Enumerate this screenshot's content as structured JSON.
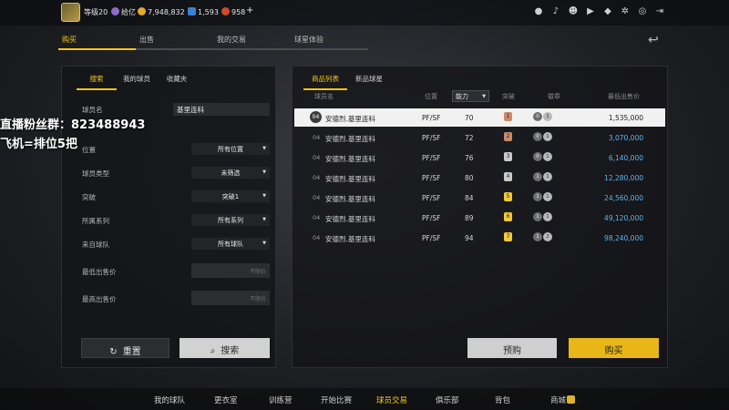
{
  "topbar": {
    "level": "等级20",
    "currency_name": "给亿",
    "coins": "7,948,832",
    "points": "1,593",
    "tickets": "958",
    "plus": "+",
    "colors": {
      "gold": "#f5c518",
      "coin": "#e4a92b",
      "point": "#3a7fd5",
      "ticket": "#d04a2a"
    }
  },
  "main_tabs": [
    "购买",
    "出售",
    "我的交易",
    "球星体验"
  ],
  "watermark": {
    "line1": "直播粉丝群：823488943",
    "line2": "飞机=排位5把"
  },
  "filters": {
    "tabs": [
      "搜索",
      "我的球员",
      "收藏夹"
    ],
    "name_label": "球员名",
    "name_value": "基里连科",
    "rows": [
      {
        "label": "位置",
        "value": "所有位置"
      },
      {
        "label": "球员类型",
        "value": "未筛选"
      },
      {
        "label": "突破",
        "value": "突破1"
      },
      {
        "label": "所属系列",
        "value": "所有系列"
      },
      {
        "label": "来自球队",
        "value": "所有球队"
      }
    ],
    "min_price_label": "最低出售价",
    "max_price_label": "最高出售价",
    "min_price_placeholder": "不限价",
    "max_price_placeholder": "不限价",
    "reset": "重置",
    "search": "搜索"
  },
  "market": {
    "tabs": [
      "商品列表",
      "新品球星"
    ],
    "columns": {
      "name": "球员名",
      "position": "位置",
      "sort": "能力",
      "breakthrough": "突破",
      "badges": "徽章",
      "price": "最低出售价"
    },
    "rows": [
      {
        "idx": "04",
        "name": "安德烈.基里连科",
        "pos": "PF/SF",
        "rating": "70",
        "br": "1",
        "b1": "0",
        "b2": "1",
        "price": "1,535,000",
        "selected": true
      },
      {
        "idx": "04",
        "name": "安德烈.基里连科",
        "pos": "PF/SF",
        "rating": "72",
        "br": "2",
        "b1": "0",
        "b2": "1",
        "price": "3,070,000"
      },
      {
        "idx": "04",
        "name": "安德烈.基里连科",
        "pos": "PF/SF",
        "rating": "76",
        "br": "3",
        "b1": "0",
        "b2": "1",
        "price": "6,140,000"
      },
      {
        "idx": "04",
        "name": "安德烈.基里连科",
        "pos": "PF/SF",
        "rating": "80",
        "br": "4",
        "b1": "1",
        "b2": "1",
        "price": "12,280,000"
      },
      {
        "idx": "04",
        "name": "安德烈.基里连科",
        "pos": "PF/SF",
        "rating": "84",
        "br": "5",
        "b1": "1",
        "b2": "1",
        "price": "24,560,000"
      },
      {
        "idx": "04",
        "name": "安德烈.基里连科",
        "pos": "PF/SF",
        "rating": "89",
        "br": "6",
        "b1": "1",
        "b2": "1",
        "price": "49,120,000"
      },
      {
        "idx": "04",
        "name": "安德烈.基里连科",
        "pos": "PF/SF",
        "rating": "94",
        "br": "7",
        "b1": "1",
        "b2": "2",
        "price": "98,240,000"
      }
    ],
    "preorder": "预购",
    "buy": "购买"
  },
  "bottom_nav": [
    "我的球队",
    "更衣室",
    "训练营",
    "开始比赛",
    "球员交易",
    "俱乐部",
    "背包",
    "商城"
  ]
}
